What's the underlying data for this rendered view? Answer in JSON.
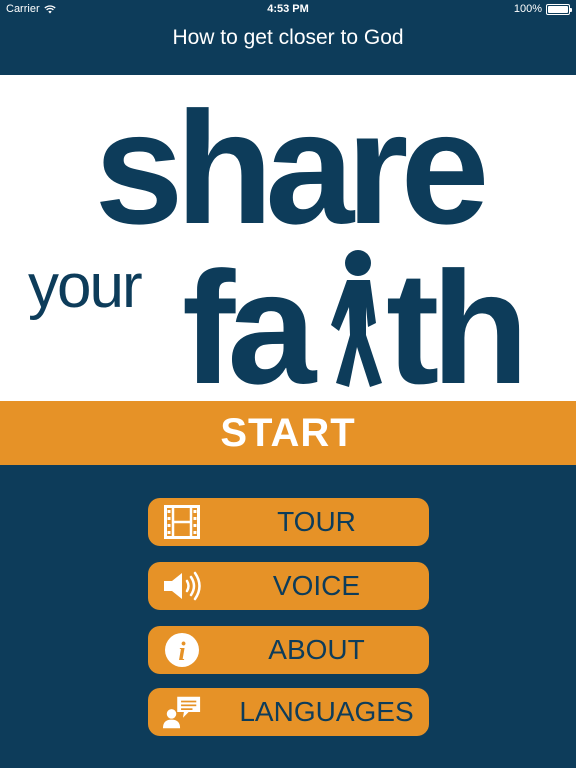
{
  "status_bar": {
    "carrier": "Carrier",
    "time": "4:53 PM",
    "battery": "100%",
    "battery_level": 1.0
  },
  "header": {
    "title": "How to get closer to God"
  },
  "logo": {
    "line1": "share",
    "line2_small": "your",
    "line2_big_a": "fa",
    "line2_big_b": "th",
    "color": "#0d3c5a"
  },
  "start_button": {
    "label": "START"
  },
  "menu": [
    {
      "label": "TOUR",
      "icon": "film-icon"
    },
    {
      "label": "VOICE",
      "icon": "speaker-icon"
    },
    {
      "label": "ABOUT",
      "icon": "info-icon"
    },
    {
      "label": "LANGUAGES",
      "icon": "speech-person-icon"
    }
  ],
  "colors": {
    "navy": "#0d3c5a",
    "orange": "#e69227",
    "white": "#ffffff"
  }
}
